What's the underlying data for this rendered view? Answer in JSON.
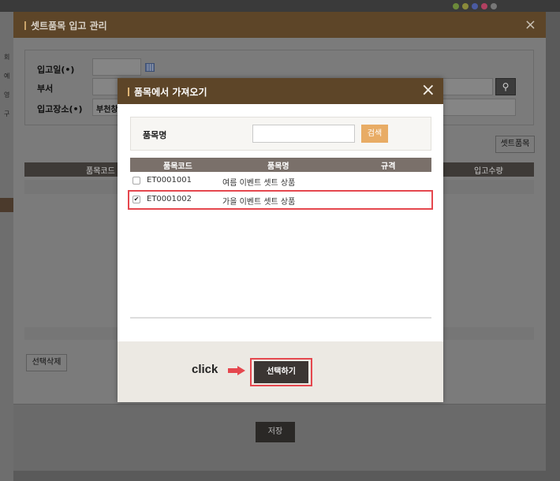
{
  "outer_window": {
    "title": "셋트품목 입고 관리",
    "close_icon": "×",
    "form": {
      "date_label": "입고일(•)",
      "dept_label": "부서",
      "location_label": "입고장소(•)",
      "location_value": "부천창"
    },
    "side_labels": [
      "회",
      "예",
      "영",
      "구"
    ],
    "set_item_button": "셋트품목",
    "grid_columns": {
      "code": "품목코드",
      "qty": "입고수량"
    },
    "delete_button": "선택삭제",
    "save_button": "저장"
  },
  "modal": {
    "title": "품목에서 가져오기",
    "close_icon": "×",
    "search": {
      "label": "품목명",
      "value": "",
      "button": "검색"
    },
    "columns": {
      "code": "품목코드",
      "name": "품목명",
      "spec": "규격"
    },
    "rows": [
      {
        "code": "ET0001001",
        "name": "여름 이벤트 셋트 상품",
        "checked": false
      },
      {
        "code": "ET0001002",
        "name": "가을 이벤트 셋트 상품",
        "checked": true
      }
    ],
    "click_hint": "click",
    "select_button": "선택하기"
  },
  "colors": {
    "header_brown": "#5d4528",
    "accent_orange": "#e8ac65",
    "highlight_red": "#e5474e",
    "table_header": "#7a706a"
  },
  "icons": {
    "search": "search-icon",
    "calendar": "calendar-icon",
    "close": "close-icon",
    "arrow": "arrow-right-icon"
  }
}
